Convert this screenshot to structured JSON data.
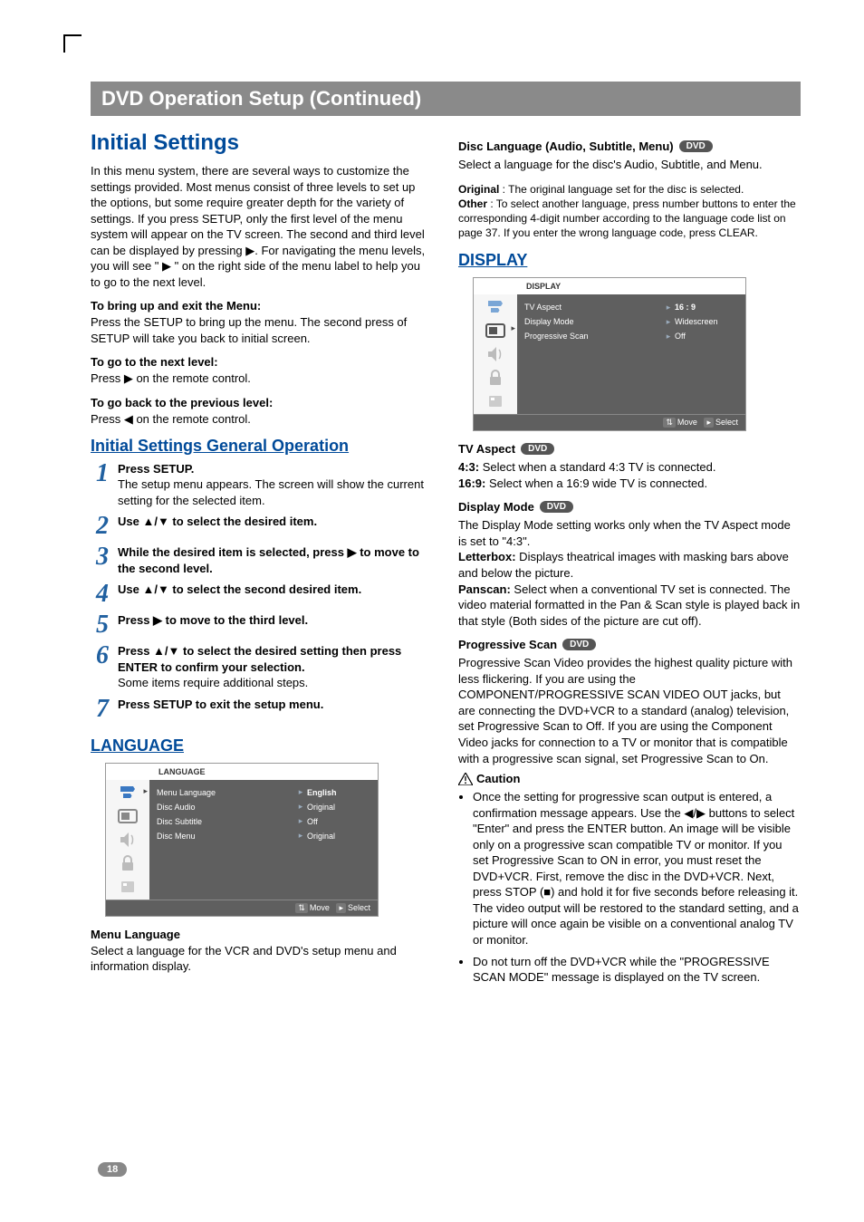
{
  "page_number": "18",
  "banner": "DVD Operation Setup (Continued)",
  "left": {
    "title": "Initial Settings",
    "intro": "In this menu system, there are several ways to customize the settings provided. Most menus consist of three levels to set up the options, but some require greater depth for the variety of settings. If you press SETUP, only the first level of the menu system will appear on the TV screen. The second and third level can be displayed by pressing ▶. For navigating the menu levels, you will see \" ▶ \" on the right side of the menu label to help you to go to the next level.",
    "bring_up_head": "To bring up and exit the Menu:",
    "bring_up_body": "Press the SETUP to bring up the menu. The second press of SETUP will take you back to initial screen.",
    "next_head": "To go to the next level:",
    "next_body": "Press ▶ on the remote control.",
    "back_head": "To go back to the previous level:",
    "back_body": "Press ◀ on the remote control.",
    "general_title": "Initial Settings General Operation",
    "steps": [
      {
        "num": "1",
        "bold": "Press SETUP.",
        "rest": "The setup menu appears. The screen will show the current setting for the selected item."
      },
      {
        "num": "2",
        "bold": "Use ▲/▼ to select the desired item.",
        "rest": ""
      },
      {
        "num": "3",
        "bold": "While the desired item is selected, press ▶ to move to the second level.",
        "rest": ""
      },
      {
        "num": "4",
        "bold": "Use ▲/▼ to select the second desired item.",
        "rest": ""
      },
      {
        "num": "5",
        "bold": "Press ▶ to move to the third level.",
        "rest": ""
      },
      {
        "num": "6",
        "bold": "Press ▲/▼ to select the desired setting then press ENTER to confirm your selection.",
        "rest": "Some items require additional steps."
      },
      {
        "num": "7",
        "bold": "Press SETUP to exit the setup menu.",
        "rest": ""
      }
    ],
    "language_title": "LANGUAGE",
    "osd_lang": {
      "header": "LANGUAGE",
      "rows": [
        {
          "name": "Menu Language",
          "val": "English"
        },
        {
          "name": "Disc Audio",
          "val": "Original"
        },
        {
          "name": "Disc Subtitle",
          "val": "Off"
        },
        {
          "name": "Disc Menu",
          "val": "Original"
        }
      ],
      "footer_move": "Move",
      "footer_select": "Select"
    },
    "menu_lang_head": "Menu Language",
    "menu_lang_body": "Select a language for the VCR and DVD's setup menu and information display."
  },
  "right": {
    "disc_lang_head": "Disc Language (Audio, Subtitle, Menu)",
    "disc_lang_body1": "Select a language for the disc's Audio, Subtitle, and Menu.",
    "disc_lang_body2_a": "Original",
    "disc_lang_body2_b": " : The original language set for the disc is selected.",
    "disc_lang_body3_a": "Other",
    "disc_lang_body3_b": " : To select another language, press number buttons to enter the corresponding 4-digit number according to the language code list on page 37. If you enter the wrong language code, press CLEAR.",
    "display_title": "DISPLAY",
    "osd_disp": {
      "header": "DISPLAY",
      "rows": [
        {
          "name": "TV Aspect",
          "val": "16 : 9"
        },
        {
          "name": "Display Mode",
          "val": "Widescreen"
        },
        {
          "name": "Progressive Scan",
          "val": "Off"
        }
      ],
      "footer_move": "Move",
      "footer_select": "Select"
    },
    "tv_aspect_head": "TV Aspect",
    "tv_aspect_43a": "4:3:",
    "tv_aspect_43b": " Select when a standard 4:3 TV is connected.",
    "tv_aspect_169a": "16:9:",
    "tv_aspect_169b": " Select when a 16:9 wide TV is connected.",
    "display_mode_head": "Display Mode",
    "display_mode_p1": "The Display Mode setting works only when the TV Aspect mode is set to \"4:3\".",
    "display_mode_lb_a": "Letterbox:",
    "display_mode_lb_b": " Displays theatrical images with masking bars above and below the picture.",
    "display_mode_ps_a": "Panscan:",
    "display_mode_ps_b": " Select when a conventional TV set is connected. The video material formatted in the Pan & Scan style is played back in that style (Both sides of the picture are cut off).",
    "prog_head": "Progressive Scan",
    "prog_body": "Progressive Scan Video provides the highest quality picture with less flickering. If you are using the COMPONENT/PROGRESSIVE SCAN VIDEO OUT jacks, but are connecting the DVD+VCR to a standard (analog) television, set Progressive Scan to Off. If you are using the Component Video jacks for connection to a TV or monitor that is compatible with a progressive scan signal, set Progressive Scan to On.",
    "caution_label": "Caution",
    "caution_items": [
      "Once the setting for progressive scan output is entered, a confirmation message appears. Use the ◀/▶ buttons to select \"Enter\" and press the ENTER button. An image will be visible only on a progressive scan compatible TV or monitor. If you set Progressive Scan to ON in error, you must reset the DVD+VCR. First, remove the disc in the DVD+VCR. Next, press STOP (■) and hold it for five seconds before releasing it. The video output will be restored to the standard setting, and a picture will once again be visible on a conventional analog TV or monitor.",
      "Do not turn off the DVD+VCR while the \"PROGRESSIVE SCAN MODE\" message is displayed on the TV screen."
    ],
    "dvd_badge": "DVD"
  }
}
